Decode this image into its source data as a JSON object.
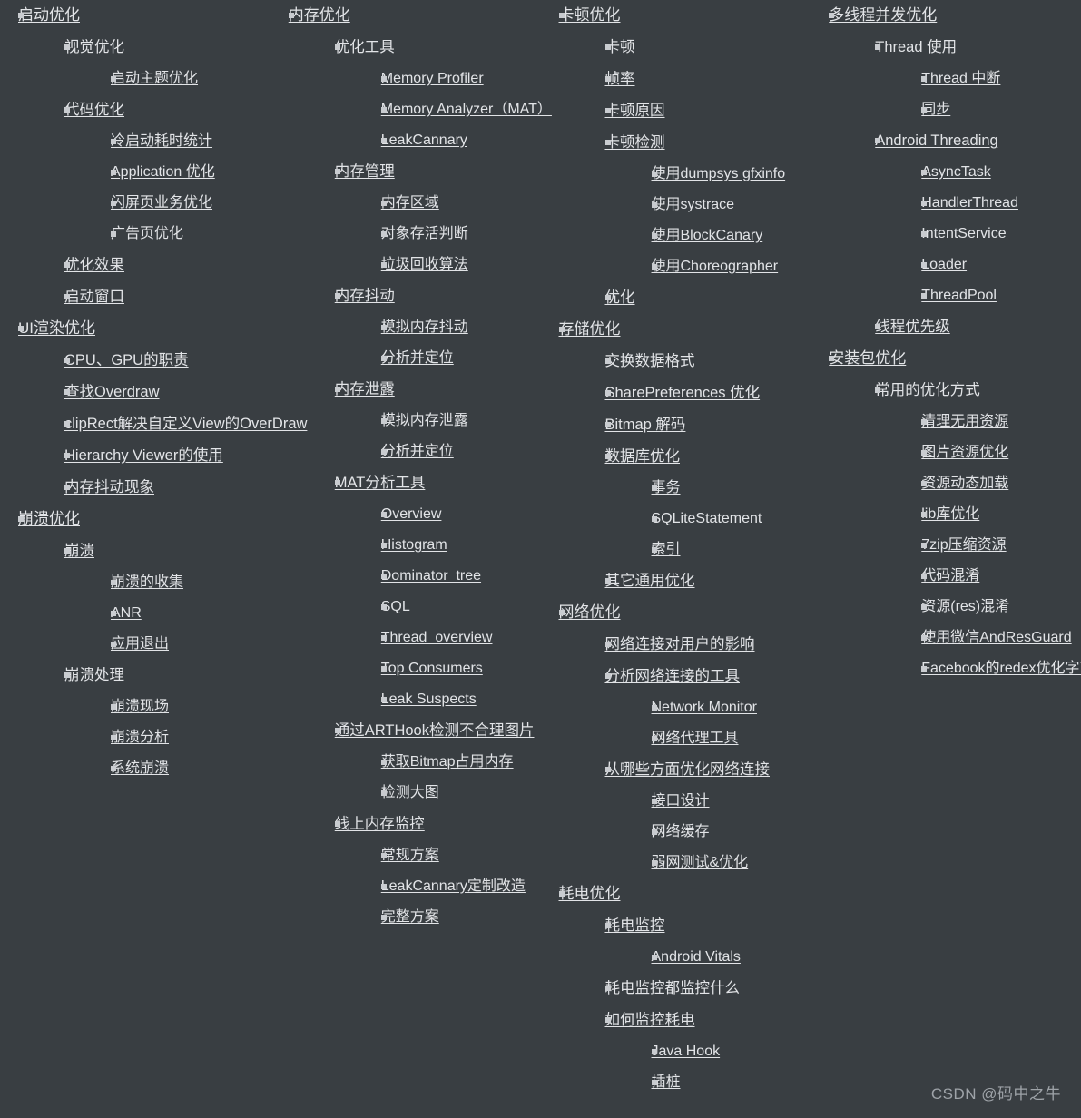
{
  "page": {
    "background_color": "#393e42",
    "text_color": "#e2e4e7",
    "bullet_color": "#c9ccd0",
    "watermark": "CSDN @码中之牛",
    "layout": "four-column flowing nested outline"
  },
  "outline": [
    {
      "label": "启动优化",
      "children": [
        {
          "label": "视觉优化",
          "children": [
            {
              "label": "启动主题优化"
            }
          ]
        },
        {
          "label": "代码优化",
          "children": [
            {
              "label": "冷启动耗时统计"
            },
            {
              "label": "Application 优化"
            },
            {
              "label": "闪屏页业务优化"
            },
            {
              "label": "广告页优化"
            }
          ]
        },
        {
          "label": "优化效果"
        },
        {
          "label": "启动窗口"
        }
      ]
    },
    {
      "label": "UI渲染优化",
      "children": [
        {
          "label": "CPU、GPU的职责"
        },
        {
          "label": "查找Overdraw"
        },
        {
          "label": "clipRect解决自定义View的OverDraw"
        },
        {
          "label": "Hierarchy Viewer的使用"
        },
        {
          "label": "内存抖动现象"
        }
      ]
    },
    {
      "label": "崩溃优化",
      "children": [
        {
          "label": "崩溃",
          "children": [
            {
              "label": "崩溃的收集"
            },
            {
              "label": "ANR"
            },
            {
              "label": "应用退出"
            }
          ]
        },
        {
          "label": "崩溃处理",
          "children": [
            {
              "label": "崩溃现场"
            },
            {
              "label": "崩溃分析"
            },
            {
              "label": "系统崩溃"
            }
          ]
        }
      ]
    },
    {
      "label": "内存优化",
      "children": [
        {
          "label": "优化工具",
          "children": [
            {
              "label": "Memory Profiler"
            },
            {
              "label": "Memory Analyzer（MAT）"
            },
            {
              "label": "LeakCannary"
            }
          ]
        },
        {
          "label": "内存管理",
          "children": [
            {
              "label": "内存区域"
            },
            {
              "label": "对象存活判断"
            },
            {
              "label": "垃圾回收算法"
            }
          ]
        },
        {
          "label": "内存抖动",
          "children": [
            {
              "label": "模拟内存抖动"
            },
            {
              "label": "分析并定位"
            }
          ]
        },
        {
          "label": "内存泄露",
          "children": [
            {
              "label": "模拟内存泄露"
            },
            {
              "label": "分析并定位"
            }
          ]
        },
        {
          "label": "MAT分析工具",
          "children": [
            {
              "label": "Overview"
            },
            {
              "label": "Histogram"
            },
            {
              "label": "Dominator_tree"
            },
            {
              "label": "SQL"
            },
            {
              "label": "Thread_overview"
            },
            {
              "label": "Top Consumers"
            },
            {
              "label": "Leak Suspects"
            }
          ]
        },
        {
          "label": "通过ARTHook检测不合理图片",
          "children": [
            {
              "label": "获取Bitmap占用内存"
            },
            {
              "label": "检测大图"
            }
          ]
        },
        {
          "label": "线上内存监控",
          "children": [
            {
              "label": "常规方案"
            },
            {
              "label": "LeakCannary定制改造"
            },
            {
              "label": "完整方案"
            }
          ]
        }
      ]
    },
    {
      "label": "卡顿优化",
      "children": [
        {
          "label": "卡顿"
        },
        {
          "label": "帧率"
        },
        {
          "label": "卡顿原因"
        },
        {
          "label": "卡顿检测",
          "children": [
            {
              "label": "使用dumpsys gfxinfo"
            },
            {
              "label": "使用systrace"
            },
            {
              "label": "使用BlockCanary"
            },
            {
              "label": "使用Choreographer"
            }
          ]
        },
        {
          "label": "优化"
        }
      ]
    },
    {
      "label": "存储优化",
      "children": [
        {
          "label": "交换数据格式"
        },
        {
          "label": "SharePreferences 优化"
        },
        {
          "label": "Bitmap 解码"
        },
        {
          "label": "数据库优化",
          "children": [
            {
              "label": "事务"
            },
            {
              "label": "SQLiteStatement"
            },
            {
              "label": "索引"
            }
          ]
        },
        {
          "label": "其它通用优化"
        }
      ]
    },
    {
      "label": "网络优化",
      "children": [
        {
          "label": "网络连接对用户的影响"
        },
        {
          "label": "分析网络连接的工具",
          "children": [
            {
              "label": "Network Monitor"
            },
            {
              "label": "网络代理工具"
            }
          ]
        },
        {
          "label": "从哪些方面优化网络连接",
          "children": [
            {
              "label": "接口设计"
            },
            {
              "label": "网络缓存"
            },
            {
              "label": "弱网测试&优化"
            }
          ]
        }
      ]
    },
    {
      "label": "耗电优化",
      "children": [
        {
          "label": "耗电监控",
          "children": [
            {
              "label": "Android Vitals"
            }
          ]
        },
        {
          "label": "耗电监控都监控什么"
        },
        {
          "label": "如何监控耗电",
          "children": [
            {
              "label": "Java Hook"
            },
            {
              "label": "插桩"
            }
          ]
        }
      ]
    },
    {
      "label": "多线程并发优化",
      "children": [
        {
          "label": "Thread 使用",
          "children": [
            {
              "label": "Thread 中断"
            },
            {
              "label": "同步"
            }
          ]
        },
        {
          "label": "Android Threading",
          "children": [
            {
              "label": "AsyncTask"
            },
            {
              "label": "HandlerThread"
            },
            {
              "label": "IntentService"
            },
            {
              "label": "Loader"
            },
            {
              "label": "ThreadPool"
            }
          ]
        },
        {
          "label": "线程优先级"
        }
      ]
    },
    {
      "label": "安装包优化",
      "children": [
        {
          "label": "常用的优化方式",
          "children": [
            {
              "label": "清理无用资源"
            },
            {
              "label": "图片资源优化"
            },
            {
              "label": "资源动态加载"
            },
            {
              "label": "lib库优化"
            },
            {
              "label": "7zip压缩资源"
            },
            {
              "label": "代码混淆"
            },
            {
              "label": "资源(res)混淆"
            },
            {
              "label": "使用微信AndResGuard"
            },
            {
              "label": "Facebook的redex优化字节码"
            }
          ]
        }
      ]
    }
  ]
}
